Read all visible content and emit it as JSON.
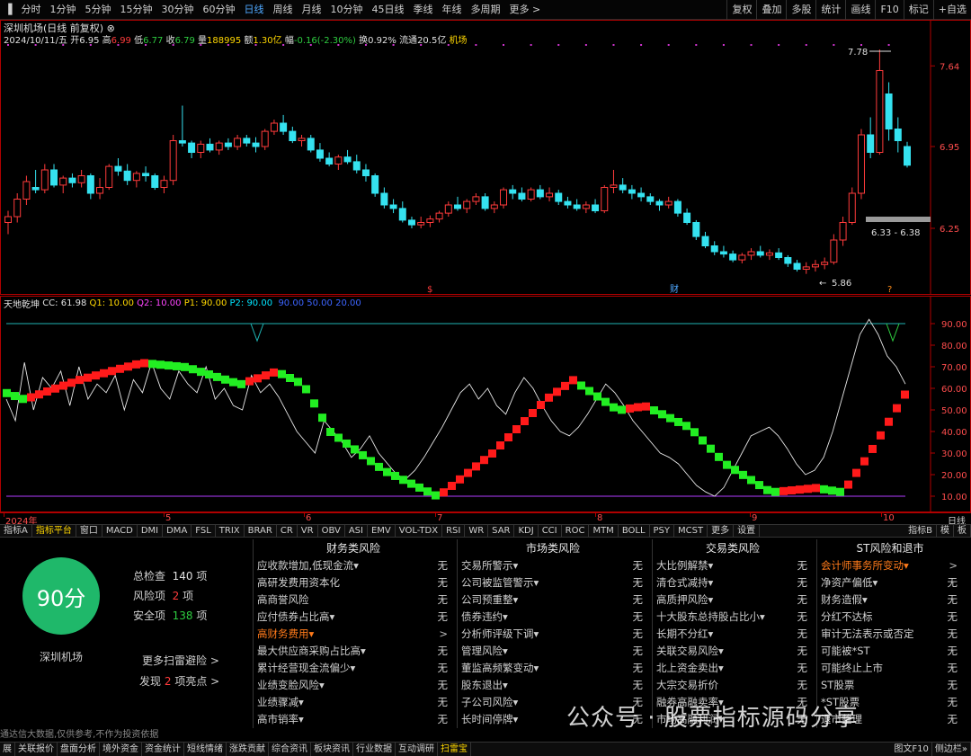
{
  "toolbar": {
    "periods": [
      "分时",
      "1分钟",
      "5分钟",
      "15分钟",
      "30分钟",
      "60分钟",
      "日线",
      "周线",
      "月线",
      "10分钟",
      "45日线",
      "季线",
      "年线",
      "多周期",
      "更多 >"
    ],
    "active_period": "日线",
    "right_buttons": [
      "复权",
      "叠加",
      "多股",
      "统计",
      "画线",
      "F10",
      "标记",
      "+自选"
    ]
  },
  "stock": {
    "title": "深圳机场(日线 前复权)",
    "date": "2024/10/11/五",
    "open_label": "开",
    "open": "6.95",
    "high_label": "高",
    "high": "6.99",
    "low_label": "低",
    "low": "6.77",
    "close_label": "收",
    "close": "6.79",
    "volume_label": "量",
    "volume": "188995",
    "amount_label": "额",
    "amount": "1.30亿",
    "change_label": "幅",
    "change": "-0.16(-2.30%)",
    "turnover_label": "换",
    "turnover": "0.92%",
    "float_label": "流通",
    "float": "20.5亿",
    "sector": "机场"
  },
  "main_axis": {
    "ticks": [
      "7.64",
      "6.95",
      "6.25"
    ],
    "min": 5.75,
    "max": 7.95
  },
  "price_labels": {
    "peak": "7.78",
    "low": "5.86",
    "range": "6.33 - 6.38"
  },
  "events": [
    "$",
    "财",
    "?"
  ],
  "indicator": {
    "name": "天地乾坤",
    "params": [
      "CC: 61.98",
      "Q1: 10.00",
      "Q2: 10.00",
      "P1: 90.00",
      "P2: 90.00",
      "90.00",
      "50.00",
      "20.00"
    ],
    "ticks": [
      "90.00",
      "80.00",
      "70.00",
      "60.00",
      "50.00",
      "40.00",
      "30.00",
      "20.00",
      "10.00"
    ]
  },
  "x_axis": [
    "2024年",
    "5",
    "6",
    "7",
    "8",
    "9",
    "10"
  ],
  "x_axis_right": "日线",
  "indicator_tabs": [
    "指标A",
    "指标平台",
    "窗口",
    "MACD",
    "DMI",
    "DMA",
    "FSL",
    "TRIX",
    "BRAR",
    "CR",
    "VR",
    "OBV",
    "ASI",
    "EMV",
    "VOL-TDX",
    "RSI",
    "WR",
    "SAR",
    "KDJ",
    "CCI",
    "ROC",
    "MTM",
    "BOLL",
    "PSY",
    "MCST",
    "更多",
    "设置"
  ],
  "indicator_tabs_selected": "指标平台",
  "indicator_tabs_right": [
    "指标B",
    "模",
    "板"
  ],
  "risk": {
    "score": "90分",
    "name": "深圳机场",
    "total_label": "总检查",
    "total": "140",
    "total_unit": "项",
    "risk_label": "风险项",
    "risk_count": "2",
    "risk_unit": "项",
    "safe_label": "安全项",
    "safe": "138",
    "safe_unit": "项",
    "more": "更多扫雷避险 >",
    "found_prefix": "发现",
    "found_count": "2",
    "found_suffix": "项亮点 >",
    "disclaimer": "通达信大数据,仅供参考,不作为投资依据",
    "columns": [
      {
        "title": "财务类风险",
        "items": [
          {
            "label": "应收款增加,低现金流▾",
            "value": "无"
          },
          {
            "label": "高研发费用资本化",
            "value": "无"
          },
          {
            "label": "高商誉风险",
            "value": "无"
          },
          {
            "label": "应付债券占比高▾",
            "value": "无"
          },
          {
            "label": "高财务费用▾",
            "value": ">",
            "hl": true
          },
          {
            "label": "最大供应商采购占比高▾",
            "value": "无"
          },
          {
            "label": "累计经营现金流偏少▾",
            "value": "无"
          },
          {
            "label": "业绩变脸风险▾",
            "value": "无"
          },
          {
            "label": "业绩骤减▾",
            "value": "无"
          },
          {
            "label": "高市销率▾",
            "value": "无"
          }
        ]
      },
      {
        "title": "市场类风险",
        "items": [
          {
            "label": "交易所警示▾",
            "value": "无"
          },
          {
            "label": "公司被监管警示▾",
            "value": "无"
          },
          {
            "label": "公司预重整▾",
            "value": "无"
          },
          {
            "label": "债券违约▾",
            "value": "无"
          },
          {
            "label": "分析师评级下调▾",
            "value": "无"
          },
          {
            "label": "管理风险▾",
            "value": "无"
          },
          {
            "label": "董监高频繁变动▾",
            "value": "无"
          },
          {
            "label": "股东退出▾",
            "value": "无"
          },
          {
            "label": "子公司风险▾",
            "value": "无"
          },
          {
            "label": "长时间停牌▾",
            "value": "无"
          }
        ]
      },
      {
        "title": "交易类风险",
        "items": [
          {
            "label": "大比例解禁▾",
            "value": "无"
          },
          {
            "label": "清仓式减持▾",
            "value": "无"
          },
          {
            "label": "高质押风险▾",
            "value": "无"
          },
          {
            "label": "十大股东总持股占比小▾",
            "value": "无"
          },
          {
            "label": "长期不分红▾",
            "value": "无"
          },
          {
            "label": "关联交易风险▾",
            "value": "无"
          },
          {
            "label": "北上资金卖出▾",
            "value": "无"
          },
          {
            "label": "大宗交易折价",
            "value": "无"
          },
          {
            "label": "融券高融卖率▾",
            "value": "无"
          },
          {
            "label": "市场高融利润▾",
            "value": "无"
          }
        ]
      },
      {
        "title": "ST风险和退市",
        "items": [
          {
            "label": "会计师事务所变动▾",
            "value": ">",
            "hl": true
          },
          {
            "label": "净资产偏低▾",
            "value": "无"
          },
          {
            "label": "财务造假▾",
            "value": "无"
          },
          {
            "label": "分红不达标",
            "value": "无"
          },
          {
            "label": "审计无法表示或否定",
            "value": "无"
          },
          {
            "label": "可能被*ST",
            "value": "无"
          },
          {
            "label": "可能终止上市",
            "value": "无"
          },
          {
            "label": "ST股票",
            "value": "无"
          },
          {
            "label": "*ST股票",
            "value": "无"
          },
          {
            "label": "退市整理",
            "value": "无"
          }
        ]
      }
    ]
  },
  "watermark": "公众号 · 股票指标源码分享",
  "statusbar": [
    "展",
    "关联报价",
    "盘面分析",
    "境外资金",
    "资金统计",
    "短线情绪",
    "涨跌贡献",
    "综合资讯",
    "板块资讯",
    "行业数据",
    "互动调研",
    "扫雷宝"
  ],
  "statusbar_selected": "扫雷宝",
  "statusbar_right": [
    "图文F10",
    "侧边栏»"
  ],
  "chart_data": {
    "type": "candlestick",
    "price_min": 5.75,
    "price_max": 7.95,
    "candles": [
      [
        6.3,
        6.4,
        6.2,
        6.35
      ],
      [
        6.35,
        6.55,
        6.3,
        6.5
      ],
      [
        6.5,
        6.7,
        6.45,
        6.65
      ],
      [
        6.6,
        6.75,
        6.55,
        6.58
      ],
      [
        6.58,
        6.8,
        6.55,
        6.75
      ],
      [
        6.75,
        6.8,
        6.6,
        6.62
      ],
      [
        6.62,
        6.7,
        6.55,
        6.68
      ],
      [
        6.68,
        6.72,
        6.6,
        6.64
      ],
      [
        6.64,
        6.75,
        6.6,
        6.7
      ],
      [
        6.7,
        6.72,
        6.5,
        6.55
      ],
      [
        6.55,
        6.68,
        6.5,
        6.6
      ],
      [
        6.6,
        6.8,
        6.58,
        6.78
      ],
      [
        6.78,
        6.85,
        6.7,
        6.74
      ],
      [
        6.74,
        6.8,
        6.62,
        6.66
      ],
      [
        6.66,
        6.74,
        6.6,
        6.72
      ],
      [
        6.72,
        6.78,
        6.65,
        6.7
      ],
      [
        6.7,
        6.72,
        6.58,
        6.6
      ],
      [
        6.6,
        6.7,
        6.55,
        6.66
      ],
      [
        6.66,
        7.05,
        6.62,
        7.0
      ],
      [
        7.0,
        7.3,
        6.95,
        6.98
      ],
      [
        6.98,
        7.0,
        6.85,
        6.9
      ],
      [
        6.9,
        7.0,
        6.85,
        6.97
      ],
      [
        6.97,
        7.02,
        6.9,
        6.92
      ],
      [
        6.92,
        7.0,
        6.88,
        6.98
      ],
      [
        6.98,
        7.02,
        6.92,
        6.95
      ],
      [
        6.95,
        7.05,
        6.92,
        7.02
      ],
      [
        7.02,
        7.05,
        6.95,
        6.98
      ],
      [
        6.98,
        7.03,
        6.9,
        6.95
      ],
      [
        6.95,
        7.1,
        6.92,
        7.08
      ],
      [
        7.08,
        7.18,
        7.05,
        7.15
      ],
      [
        7.15,
        7.22,
        7.05,
        7.08
      ],
      [
        7.08,
        7.12,
        6.98,
        7.0
      ],
      [
        7.0,
        7.05,
        6.95,
        7.02
      ],
      [
        7.02,
        7.05,
        6.9,
        6.92
      ],
      [
        6.92,
        6.98,
        6.82,
        6.85
      ],
      [
        6.85,
        6.9,
        6.78,
        6.8
      ],
      [
        6.8,
        6.88,
        6.75,
        6.86
      ],
      [
        6.86,
        6.92,
        6.8,
        6.82
      ],
      [
        6.82,
        6.88,
        6.72,
        6.75
      ],
      [
        6.75,
        6.8,
        6.65,
        6.7
      ],
      [
        6.7,
        6.72,
        6.52,
        6.55
      ],
      [
        6.55,
        6.6,
        6.42,
        6.45
      ],
      [
        6.45,
        6.5,
        6.38,
        6.42
      ],
      [
        6.42,
        6.48,
        6.3,
        6.32
      ],
      [
        6.32,
        6.35,
        6.25,
        6.28
      ],
      [
        6.28,
        6.35,
        6.25,
        6.3
      ],
      [
        6.3,
        6.36,
        6.26,
        6.33
      ],
      [
        6.33,
        6.4,
        6.3,
        6.38
      ],
      [
        6.38,
        6.48,
        6.35,
        6.45
      ],
      [
        6.45,
        6.52,
        6.4,
        6.42
      ],
      [
        6.42,
        6.5,
        6.38,
        6.48
      ],
      [
        6.48,
        6.55,
        6.45,
        6.52
      ],
      [
        6.52,
        6.55,
        6.4,
        6.42
      ],
      [
        6.42,
        6.48,
        6.38,
        6.45
      ],
      [
        6.45,
        6.6,
        6.42,
        6.58
      ],
      [
        6.58,
        6.62,
        6.5,
        6.55
      ],
      [
        6.55,
        6.6,
        6.48,
        6.5
      ],
      [
        6.5,
        6.6,
        6.48,
        6.58
      ],
      [
        6.58,
        6.62,
        6.5,
        6.52
      ],
      [
        6.52,
        6.6,
        6.48,
        6.55
      ],
      [
        6.55,
        6.58,
        6.45,
        6.48
      ],
      [
        6.48,
        6.52,
        6.42,
        6.45
      ],
      [
        6.45,
        6.5,
        6.4,
        6.42
      ],
      [
        6.42,
        6.48,
        6.38,
        6.45
      ],
      [
        6.45,
        6.5,
        6.38,
        6.4
      ],
      [
        6.4,
        6.62,
        6.38,
        6.6
      ],
      [
        6.6,
        6.75,
        6.55,
        6.62
      ],
      [
        6.62,
        6.68,
        6.55,
        6.58
      ],
      [
        6.58,
        6.62,
        6.5,
        6.55
      ],
      [
        6.55,
        6.6,
        6.48,
        6.52
      ],
      [
        6.52,
        6.55,
        6.45,
        6.48
      ],
      [
        6.48,
        6.5,
        6.4,
        6.45
      ],
      [
        6.45,
        6.52,
        6.42,
        6.48
      ],
      [
        6.48,
        6.5,
        6.35,
        6.38
      ],
      [
        6.38,
        6.42,
        6.28,
        6.3
      ],
      [
        6.3,
        6.32,
        6.15,
        6.18
      ],
      [
        6.18,
        6.22,
        6.08,
        6.1
      ],
      [
        6.1,
        6.14,
        6.02,
        6.05
      ],
      [
        6.05,
        6.1,
        6.0,
        6.03
      ],
      [
        6.03,
        6.06,
        5.96,
        5.98
      ],
      [
        5.98,
        6.04,
        5.95,
        6.02
      ],
      [
        6.02,
        6.08,
        5.98,
        6.05
      ],
      [
        6.05,
        6.1,
        6.0,
        6.02
      ],
      [
        6.02,
        6.07,
        5.98,
        6.04
      ],
      [
        6.04,
        6.08,
        5.98,
        6.0
      ],
      [
        6.0,
        6.02,
        5.92,
        5.95
      ],
      [
        5.95,
        5.98,
        5.88,
        5.9
      ],
      [
        5.9,
        5.96,
        5.86,
        5.92
      ],
      [
        5.92,
        5.98,
        5.88,
        5.94
      ],
      [
        5.94,
        6.0,
        5.9,
        5.96
      ],
      [
        5.96,
        6.2,
        5.94,
        6.15
      ],
      [
        6.15,
        6.35,
        6.1,
        6.3
      ],
      [
        6.3,
        6.6,
        6.28,
        6.55
      ],
      [
        6.55,
        7.1,
        6.5,
        7.05
      ],
      [
        7.05,
        7.2,
        6.85,
        6.9
      ],
      [
        6.9,
        7.78,
        6.88,
        7.6
      ],
      [
        7.4,
        7.5,
        7.0,
        7.1
      ],
      [
        7.1,
        7.2,
        6.9,
        7.0
      ],
      [
        6.95,
        6.99,
        6.77,
        6.79
      ]
    ]
  }
}
